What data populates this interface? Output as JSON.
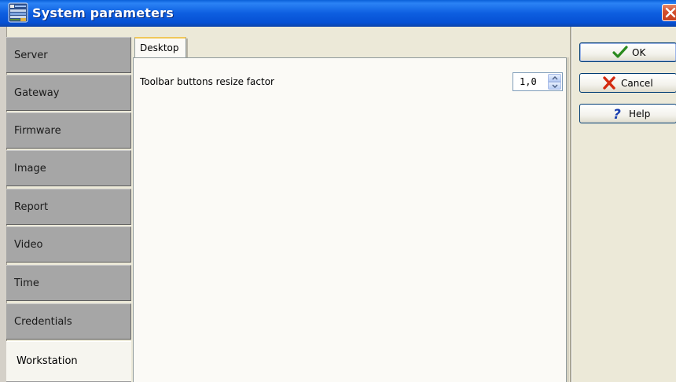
{
  "window": {
    "title": "System parameters",
    "icon": "system-parameters-icon",
    "close_icon": "close-icon",
    "titlebar_color": "#0a5fd8"
  },
  "sidebar": {
    "items": [
      {
        "label": "Server"
      },
      {
        "label": "Gateway"
      },
      {
        "label": "Firmware"
      },
      {
        "label": "Image"
      },
      {
        "label": "Report"
      },
      {
        "label": "Video"
      },
      {
        "label": "Time"
      },
      {
        "label": "Credentials"
      },
      {
        "label": "Workstation"
      }
    ],
    "selected": "Workstation"
  },
  "tabs": [
    {
      "label": "Desktop",
      "selected": true
    }
  ],
  "desktop": {
    "toolbar_resize_label": "Toolbar buttons resize factor",
    "toolbar_resize_value": "1,0"
  },
  "buttons": {
    "ok": {
      "label": "OK",
      "icon": "checkmark-icon"
    },
    "cancel": {
      "label": "Cancel",
      "icon": "x-icon"
    },
    "help": {
      "label": "Help",
      "icon": "question-mark-icon"
    }
  }
}
